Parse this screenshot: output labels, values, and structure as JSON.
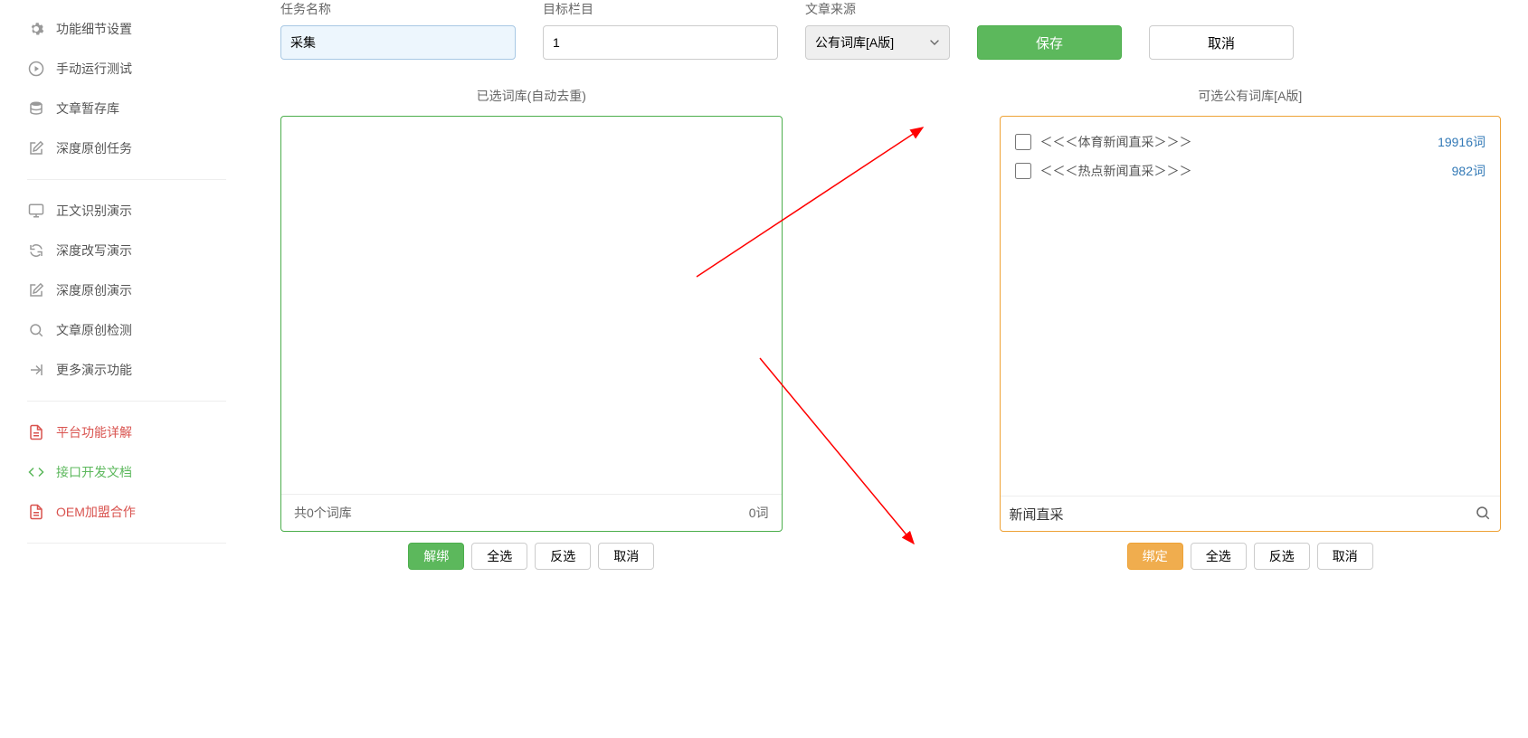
{
  "sidebar": {
    "items": [
      {
        "label": "功能细节设置"
      },
      {
        "label": "手动运行测试"
      },
      {
        "label": "文章暂存库"
      },
      {
        "label": "深度原创任务"
      },
      {
        "label": "正文识别演示"
      },
      {
        "label": "深度改写演示"
      },
      {
        "label": "深度原创演示"
      },
      {
        "label": "文章原创检测"
      },
      {
        "label": "更多演示功能"
      },
      {
        "label": "平台功能详解"
      },
      {
        "label": "接口开发文档"
      },
      {
        "label": "OEM加盟合作"
      }
    ]
  },
  "form": {
    "task_name_label": "任务名称",
    "task_name_value": "采集",
    "target_column_label": "目标栏目",
    "target_column_value": "1",
    "source_label": "文章来源",
    "source_value": "公有词库[A版]",
    "save": "保存",
    "cancel": "取消"
  },
  "left_panel": {
    "title": "已选词库(自动去重)",
    "summary_left": "共0个词库",
    "summary_right": "0词",
    "buttons": {
      "unbind": "解绑",
      "select_all": "全选",
      "invert": "反选",
      "cancel": "取消"
    }
  },
  "right_panel": {
    "title": "可选公有词库[A版]",
    "items": [
      {
        "name": "＜＜＜体育新闻直采＞＞＞",
        "count": "19916词"
      },
      {
        "name": "＜＜＜热点新闻直采＞＞＞",
        "count": "982词"
      }
    ],
    "search_value": "新闻直采",
    "buttons": {
      "bind": "绑定",
      "select_all": "全选",
      "invert": "反选",
      "cancel": "取消"
    }
  }
}
